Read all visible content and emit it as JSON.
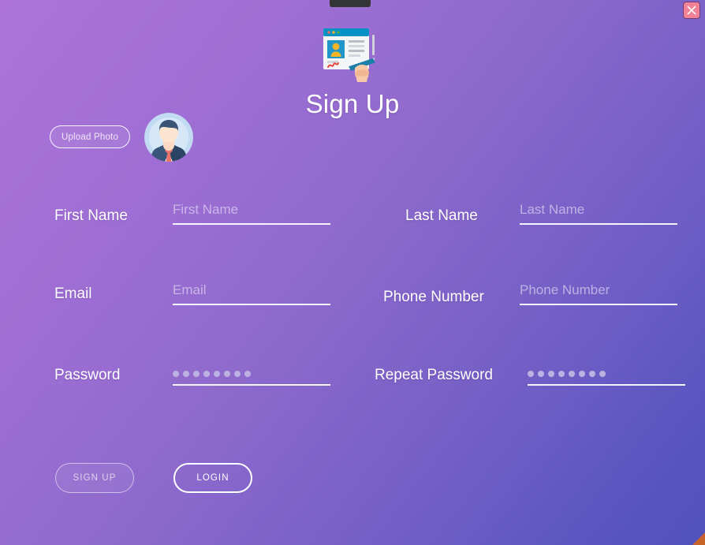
{
  "window": {
    "close_icon": "close-icon",
    "resize_handle": "resize-corner-handle"
  },
  "header": {
    "illustration_icon": "signup-form-illustration-icon",
    "title": "Sign Up"
  },
  "photo": {
    "upload_label": "Upload Photo",
    "avatar_icon": "businessman-avatar-icon"
  },
  "form": {
    "fields": [
      {
        "name": "first-name",
        "label": "First Name",
        "placeholder": "First Name",
        "value": "",
        "type": "text"
      },
      {
        "name": "last-name",
        "label": "Last Name",
        "placeholder": "Last Name",
        "value": "",
        "type": "text"
      },
      {
        "name": "email",
        "label": "Email",
        "placeholder": "Email",
        "value": "",
        "type": "text"
      },
      {
        "name": "phone-number",
        "label": "Phone Number",
        "placeholder": "Phone Number",
        "value": "",
        "type": "text"
      },
      {
        "name": "password",
        "label": "Password",
        "placeholder": "",
        "masked_char_count": 8,
        "type": "password"
      },
      {
        "name": "repeat-password",
        "label": "Repeat Password",
        "masked_char_count": 8,
        "placeholder": "",
        "type": "password"
      }
    ]
  },
  "actions": {
    "signup_label": "SIGN UP",
    "login_label": "LOGIN"
  },
  "colors": {
    "gradient_start": "#ac74d9",
    "gradient_end": "#5152bd",
    "field_underline": "#ffffff",
    "placeholder": "#e8e2f5",
    "password_dot": "#bcb2e2",
    "close_button": "#ef8295",
    "resize_corner": "#c8642a",
    "avatar_bg": "#c3dbf2",
    "avatar_suit": "#2f4a6b",
    "avatar_tie": "#e8746c"
  }
}
